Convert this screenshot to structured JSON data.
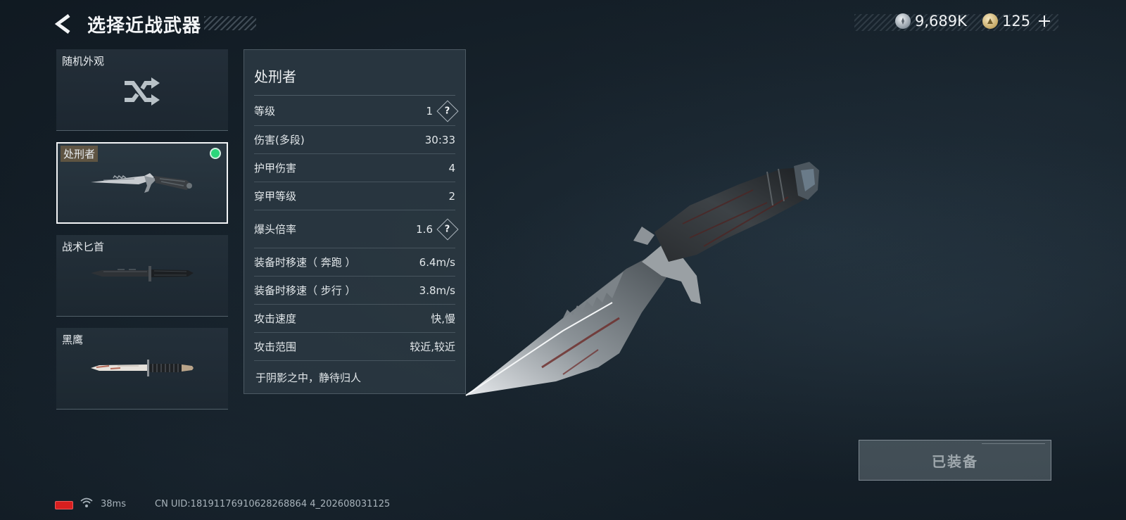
{
  "header": {
    "title": "选择近战武器"
  },
  "currencies": [
    {
      "icon": "silver-coin-icon",
      "value": "9,689K"
    },
    {
      "icon": "gold-coin-icon",
      "value": "125"
    }
  ],
  "weapon_list": [
    {
      "name": "随机外观",
      "icon": "shuffle-icon",
      "selected": false
    },
    {
      "name": "处刑者",
      "icon": "executioner-knife-icon",
      "selected": true,
      "equipped": true
    },
    {
      "name": "战术匕首",
      "icon": "tactical-dagger-icon",
      "selected": false
    },
    {
      "name": "黑鹰",
      "icon": "black-eagle-knife-icon",
      "selected": false
    }
  ],
  "stats": {
    "title": "处刑者",
    "rows": [
      {
        "label": "等级",
        "value": "1",
        "help": true
      },
      {
        "label": "伤害(多段)",
        "value": "30:33",
        "help": false
      },
      {
        "label": "护甲伤害",
        "value": "4",
        "help": false
      },
      {
        "label": "穿甲等级",
        "value": "2",
        "help": false
      },
      {
        "label": "爆头倍率",
        "value": "1.6",
        "help": true
      },
      {
        "label": "装备时移速（ 奔跑 ）",
        "value": "6.4m/s",
        "help": false
      },
      {
        "label": "装备时移速（ 步行 ）",
        "value": "3.8m/s",
        "help": false
      },
      {
        "label": "攻击速度",
        "value": "快,慢",
        "help": false
      },
      {
        "label": "攻击范围",
        "value": "较近,较近",
        "help": false
      }
    ],
    "flavor": "于阴影之中，静待归人"
  },
  "equip_button": {
    "label": "已装备"
  },
  "footer": {
    "ping": "38ms",
    "uid": "CN UID:18191176910628268864 4_202608031125"
  },
  "colors": {
    "equipped_dot": "#2bd67b",
    "battery_low": "#d81f1f"
  }
}
